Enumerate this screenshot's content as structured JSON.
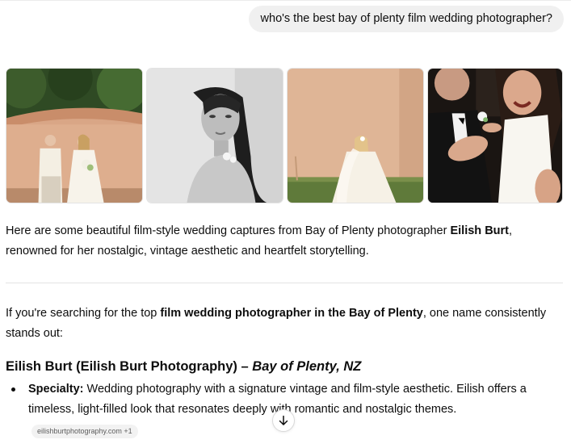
{
  "user_message": "who's the best bay of plenty film wedding photographer?",
  "images": [
    {
      "icon": "couple-by-pink-wall-photo"
    },
    {
      "icon": "bride-bw-portrait-photo"
    },
    {
      "icon": "bride-on-lawn-photo"
    },
    {
      "icon": "couple-laughing-photo"
    }
  ],
  "intro": {
    "text_1": "Here are some beautiful film-style wedding captures from Bay of Plenty photographer ",
    "bold_name": "Eilish Burt",
    "text_2": ", renowned for her nostalgic, vintage aesthetic and heartfelt storytelling."
  },
  "answer": {
    "text_1": "If you're searching for the top ",
    "bold_phrase": "film wedding photographer in the Bay of Plenty",
    "text_2": ", one name consistently stands out:"
  },
  "section_heading": {
    "name": "Eilish Burt (Eilish Burt Photography) – ",
    "location": "Bay of Plenty, NZ"
  },
  "bullets": [
    {
      "label": "Specialty:",
      "text": " Wedding photography with a signature vintage and film-style aesthetic. Eilish offers a timeless, light-filled look that resonates deeply with romantic and nostalgic themes."
    }
  ],
  "source_chip": "eilishburtphotography.com +1",
  "scroll_button": {
    "icon": "arrow-down-icon"
  }
}
